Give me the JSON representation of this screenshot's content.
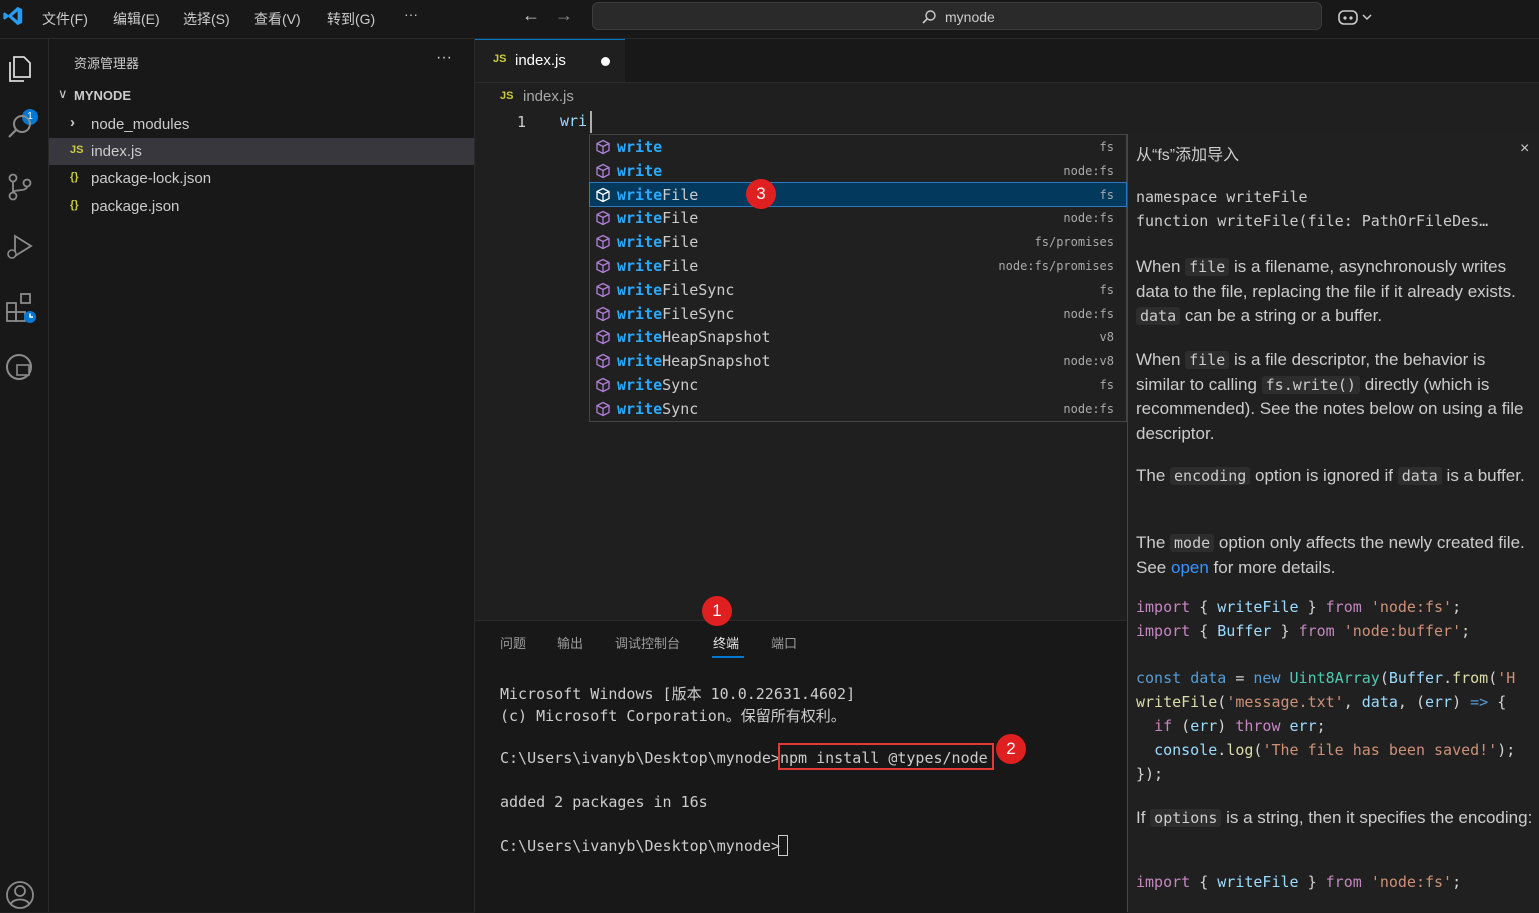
{
  "titlebar": {
    "menus": [
      "文件(F)",
      "编辑(E)",
      "选择(S)",
      "查看(V)",
      "转到(G)",
      "···"
    ],
    "search": "mynode"
  },
  "activity": {
    "badge": "1"
  },
  "explorer": {
    "title": "资源管理器",
    "more": "···",
    "folder": "MYNODE",
    "items": [
      {
        "icon": "›",
        "name": "node_modules"
      },
      {
        "icon": "JS",
        "name": "index.js"
      },
      {
        "icon": "{}",
        "name": "package-lock.json"
      },
      {
        "icon": "{}",
        "name": "package.json"
      }
    ]
  },
  "editor": {
    "tab": {
      "icon": "JS",
      "name": "index.js"
    },
    "breadcrumb": {
      "icon": "JS",
      "name": "index.js"
    },
    "line_number": "1",
    "code": "wri"
  },
  "suggest": {
    "items": [
      {
        "match": "write",
        "rest": "",
        "detail": "fs"
      },
      {
        "match": "write",
        "rest": "",
        "detail": "node:fs"
      },
      {
        "match": "write",
        "rest": "File",
        "detail": "fs"
      },
      {
        "match": "write",
        "rest": "File",
        "detail": "node:fs"
      },
      {
        "match": "write",
        "rest": "File",
        "detail": "fs/promises"
      },
      {
        "match": "write",
        "rest": "File",
        "detail": "node:fs/promises"
      },
      {
        "match": "write",
        "rest": "FileSync",
        "detail": "fs"
      },
      {
        "match": "write",
        "rest": "FileSync",
        "detail": "node:fs"
      },
      {
        "match": "write",
        "rest": "HeapSnapshot",
        "detail": "v8"
      },
      {
        "match": "write",
        "rest": "HeapSnapshot",
        "detail": "node:v8"
      },
      {
        "match": "write",
        "rest": "Sync",
        "detail": "fs"
      },
      {
        "match": "write",
        "rest": "Sync",
        "detail": "node:fs"
      }
    ]
  },
  "details": {
    "header": "从“fs”添加导入",
    "close": "×",
    "sig1": "namespace writeFile",
    "sig2": "function writeFile(file: PathOrFileDes…",
    "p1": {
      "a": "When ",
      "c1": "file",
      "b": " is a filename, asynchronously writes data to the file, replacing the file if it already exists. ",
      "c2": "data",
      "d": " can be a string or a buffer."
    },
    "p2": {
      "a": "When ",
      "c1": "file",
      "b": " is a file descriptor, the behavior is similar to calling ",
      "c2": "fs.write()",
      "d": " directly (which is recommended). See the notes below on using a file descriptor."
    },
    "p3": {
      "a": "The ",
      "c1": "encoding",
      "b": " option is ignored if ",
      "c2": "data",
      "d": " is a buffer."
    },
    "p4": {
      "a": "The ",
      "c1": "mode",
      "b": " option only affects the newly created file. See ",
      "link": "open",
      "d": " for more details."
    },
    "p5": {
      "a": "If ",
      "c1": "options",
      "b": " is a string, then it specifies the encoding:"
    },
    "code": {
      "l1": [
        "import",
        " { ",
        "writeFile",
        " } ",
        "from",
        " ",
        "'node:fs'",
        ";"
      ],
      "l2": [
        "import",
        " { ",
        "Buffer",
        " } ",
        "from",
        " ",
        "'node:buffer'",
        ";"
      ],
      "l3": [
        "const",
        " ",
        "data",
        " = ",
        "new",
        " ",
        "Uint8Array",
        "(",
        "Buffer",
        ".",
        "from",
        "(",
        "'H"
      ],
      "l4": [
        "writeFile",
        "(",
        "'message.txt'",
        ", ",
        "data",
        ", (",
        "err",
        ") ",
        "=>",
        " {"
      ],
      "l5": [
        "  ",
        "if",
        " (",
        "err",
        ") ",
        "throw",
        " ",
        "err",
        ";"
      ],
      "l6": [
        "  ",
        "console",
        ".",
        "log",
        "(",
        "'The file has been saved!'",
        ");"
      ],
      "l7": [
        "});"
      ],
      "l8": [
        "import",
        " { ",
        "writeFile",
        " } ",
        "from",
        " ",
        "'node:fs'",
        ";"
      ]
    }
  },
  "panel": {
    "tabs": [
      "问题",
      "输出",
      "调试控制台",
      "终端",
      "端口"
    ],
    "terminal": {
      "l1": "Microsoft Windows [版本 10.0.22631.4602]",
      "l2": "(c) Microsoft Corporation。保留所有权利。",
      "l3_prompt": "C:\\Users\\ivanyb\\Desktop\\mynode>",
      "l3_cmd": "npm install @types/node",
      "l4": "added 2 packages in 16s",
      "l5_prompt": "C:\\Users\\ivanyb\\Desktop\\mynode>"
    }
  },
  "annotations": {
    "n1": "1",
    "n2": "2",
    "n3": "3"
  },
  "colors": {
    "accent": "#0078d4",
    "annotation": "#e02020",
    "selection": "#04395e",
    "match": "#2aaaff"
  }
}
